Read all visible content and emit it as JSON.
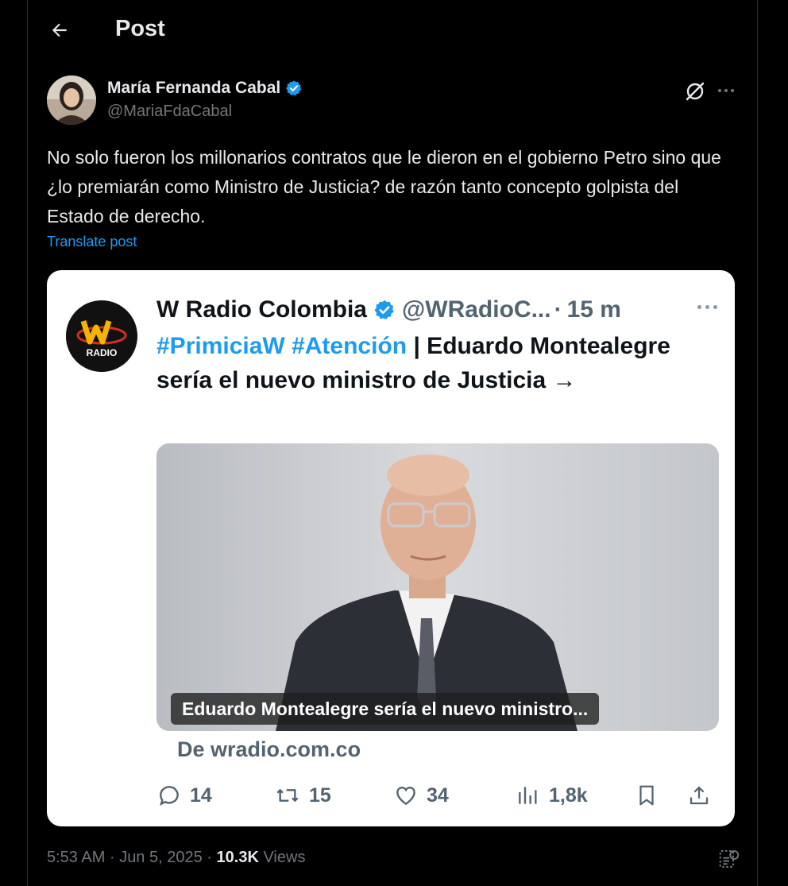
{
  "header": {
    "title": "Post"
  },
  "author": {
    "name": "María Fernanda Cabal",
    "handle": "@MariaFdaCabal",
    "verified": true
  },
  "post": {
    "text": "No solo fueron los millonarios contratos que le dieron en el gobierno Petro sino que ¿lo premiarán como Ministro de Justicia? de razón tanto concepto golpista del Estado de derecho.",
    "translate_label": "Translate post"
  },
  "quoted": {
    "name": "W Radio Colombia",
    "handle": "@WRadioC...",
    "dot": "·",
    "time": "15 m",
    "hashtag1": "#PrimiciaW",
    "hashtag2": "#Atención",
    "text": "| Eduardo Montealegre sería el nuevo ministro de Justicia →",
    "media_caption": "Eduardo Montealegre sería el nuevo ministro...",
    "source": "De wradio.com.co",
    "logo_text": "RADIO",
    "actions": {
      "replies": "14",
      "reposts": "15",
      "likes": "34",
      "views": "1,8k"
    }
  },
  "meta": {
    "time": "5:53 AM",
    "sep1": "·",
    "date": "Jun 5, 2025",
    "sep2": "·",
    "views_count": "10.3K",
    "views_label": "Views"
  },
  "colors": {
    "background": "#000000",
    "accent": "#1d9bf0",
    "card": "#ffffff",
    "muted": "#71767b"
  }
}
